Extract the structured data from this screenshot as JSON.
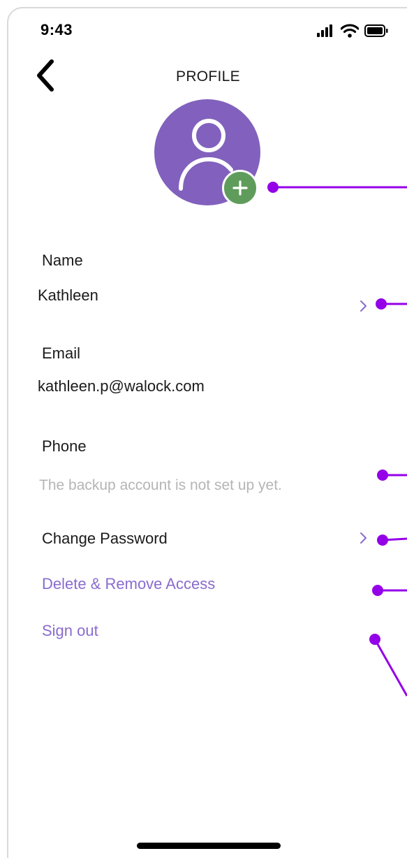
{
  "status_bar": {
    "time": "9:43",
    "icons": [
      "signal-icon",
      "wifi-icon",
      "battery-icon"
    ]
  },
  "header": {
    "back_icon": "chevron-left-icon",
    "title": "PROFILE"
  },
  "avatar": {
    "icon": "user-icon",
    "add_icon": "plus-icon",
    "add_symbol": "+",
    "background": "#8161bd",
    "add_background": "#5f9c5b"
  },
  "profile": {
    "name_label": "Name",
    "name_value": "Kathleen",
    "email_label": "Email",
    "email_value": "kathleen.p@walock.com",
    "phone_label": "Phone",
    "phone_hint": "The backup account is not set up yet."
  },
  "actions": {
    "change_password": "Change Password",
    "delete_access": "Delete & Remove Access",
    "sign_out": "Sign out"
  },
  "colors": {
    "accent": "#8a6bce",
    "callout": "#9400e8",
    "hint_text": "#b5b5b5"
  }
}
